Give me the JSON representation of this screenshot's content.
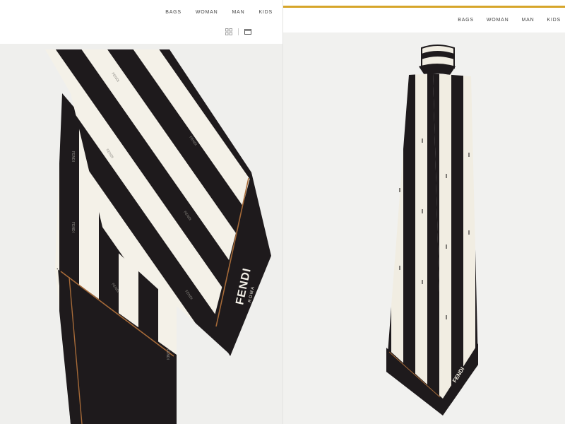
{
  "left_panel": {
    "nav": [
      "BAGS",
      "WOMAN",
      "MAN",
      "KIDS"
    ],
    "view_toggles": [
      "grid-view-icon",
      "single-view-icon"
    ],
    "product": {
      "brand": "FENDI",
      "sub": "ROMA",
      "pattern_text": "FENDI"
    }
  },
  "right_panel": {
    "nav": [
      "BAGS",
      "WOMAN",
      "MAN",
      "KIDS"
    ],
    "product": {
      "brand": "FENDI",
      "pattern_text": "FENDI"
    }
  },
  "colors": {
    "stripe_dark": "#1e1a1c",
    "stripe_light": "#f4f1e8",
    "edge_brown": "#a66a38",
    "gold": "#d6a52a"
  }
}
